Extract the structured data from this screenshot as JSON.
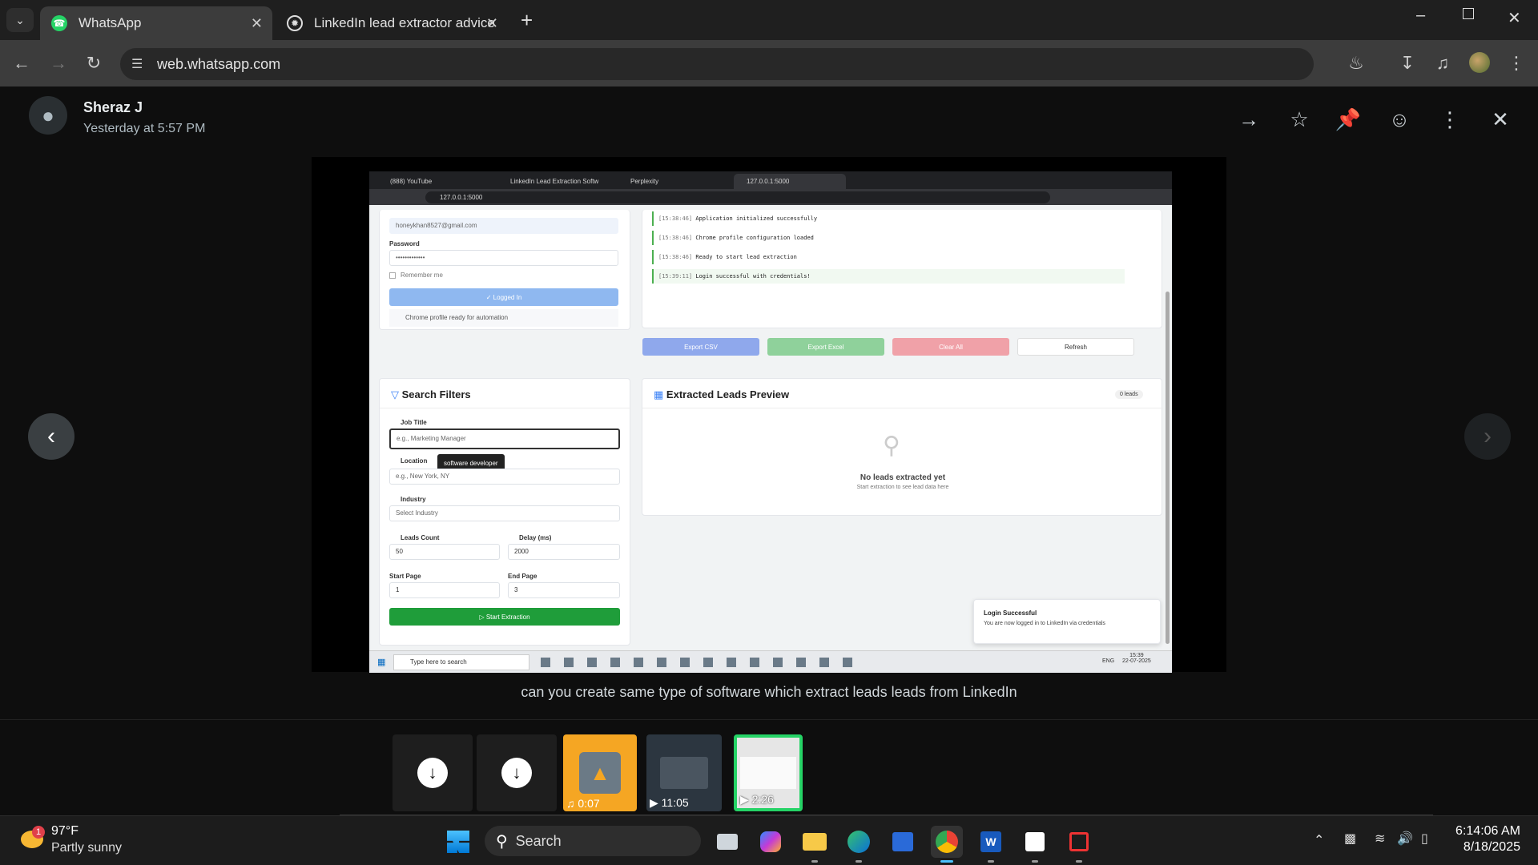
{
  "browser": {
    "tabs": [
      {
        "label": "WhatsApp",
        "icon": "whatsapp-icon"
      },
      {
        "label": "LinkedIn lead extractor advice",
        "icon": "openai-icon"
      }
    ],
    "url": "web.whatsapp.com"
  },
  "viewer": {
    "sender": "Sheraz J",
    "timestamp": "Yesterday at 5:57 PM",
    "caption": "can you create same type of software which extract leads leads from LinkedIn",
    "thumbnails": [
      {
        "type": "download",
        "label": ""
      },
      {
        "type": "download",
        "label": ""
      },
      {
        "type": "audio",
        "label": "0:07"
      },
      {
        "type": "video",
        "label": "11:05"
      },
      {
        "type": "video",
        "label": "2:26"
      }
    ]
  },
  "shot": {
    "tabs": [
      "(888) YouTube",
      "LinkedIn Lead Extraction Softw",
      "Perplexity",
      "127.0.0.1:5000"
    ],
    "url": "127.0.0.1:5000",
    "email_value": "honeykhan8527@gmail.com",
    "password_label": "Password",
    "password_value": "•••••••••••••",
    "remember": "Remember me",
    "logged_in": "Logged In",
    "chrome_profile": "Chrome profile ready for automation",
    "logs": [
      {
        "time": "[15:38:46]",
        "msg": "Application initialized successfully"
      },
      {
        "time": "[15:38:46]",
        "msg": "Chrome profile configuration loaded"
      },
      {
        "time": "[15:38:46]",
        "msg": "Ready to start lead extraction"
      },
      {
        "time": "[15:39:11]",
        "msg": "Login successful with credentials!"
      }
    ],
    "export_csv": "Export CSV",
    "export_excel": "Export Excel",
    "clear_all": "Clear All",
    "refresh": "Refresh",
    "filters_title": "Search Filters",
    "job_title_label": "Job Title",
    "job_title_placeholder": "e.g., Marketing Manager",
    "autocomplete": "software developer",
    "location_label": "Location",
    "location_placeholder": "e.g., New York, NY",
    "industry_label": "Industry",
    "industry_value": "Select Industry",
    "leads_count_label": "Leads Count",
    "leads_count_value": "50",
    "delay_label": "Delay (ms)",
    "delay_value": "2000",
    "start_page_label": "Start Page",
    "start_page_value": "1",
    "end_page_label": "End Page",
    "end_page_value": "3",
    "start_extraction": "Start Extraction",
    "preview_title": "Extracted Leads Preview",
    "leads_badge": "0 leads",
    "empty_title": "No leads extracted yet",
    "empty_sub": "Start extraction to see lead data here",
    "toast_title": "Login Successful",
    "toast_msg": "You are now logged in to LinkedIn via credentials",
    "taskbar_search": "Type here to search",
    "lang": "ENG",
    "clock_time": "15:39",
    "clock_date": "22-07-2025"
  },
  "taskbar": {
    "weather_badge": "1",
    "temperature": "97°F",
    "condition": "Partly sunny",
    "search": "Search",
    "time": "6:14:06 AM",
    "date": "8/18/2025"
  },
  "colors": {
    "wa_green": "#25d366",
    "accent_blue": "#8fb8f0",
    "start_green": "#1f9d3a"
  }
}
